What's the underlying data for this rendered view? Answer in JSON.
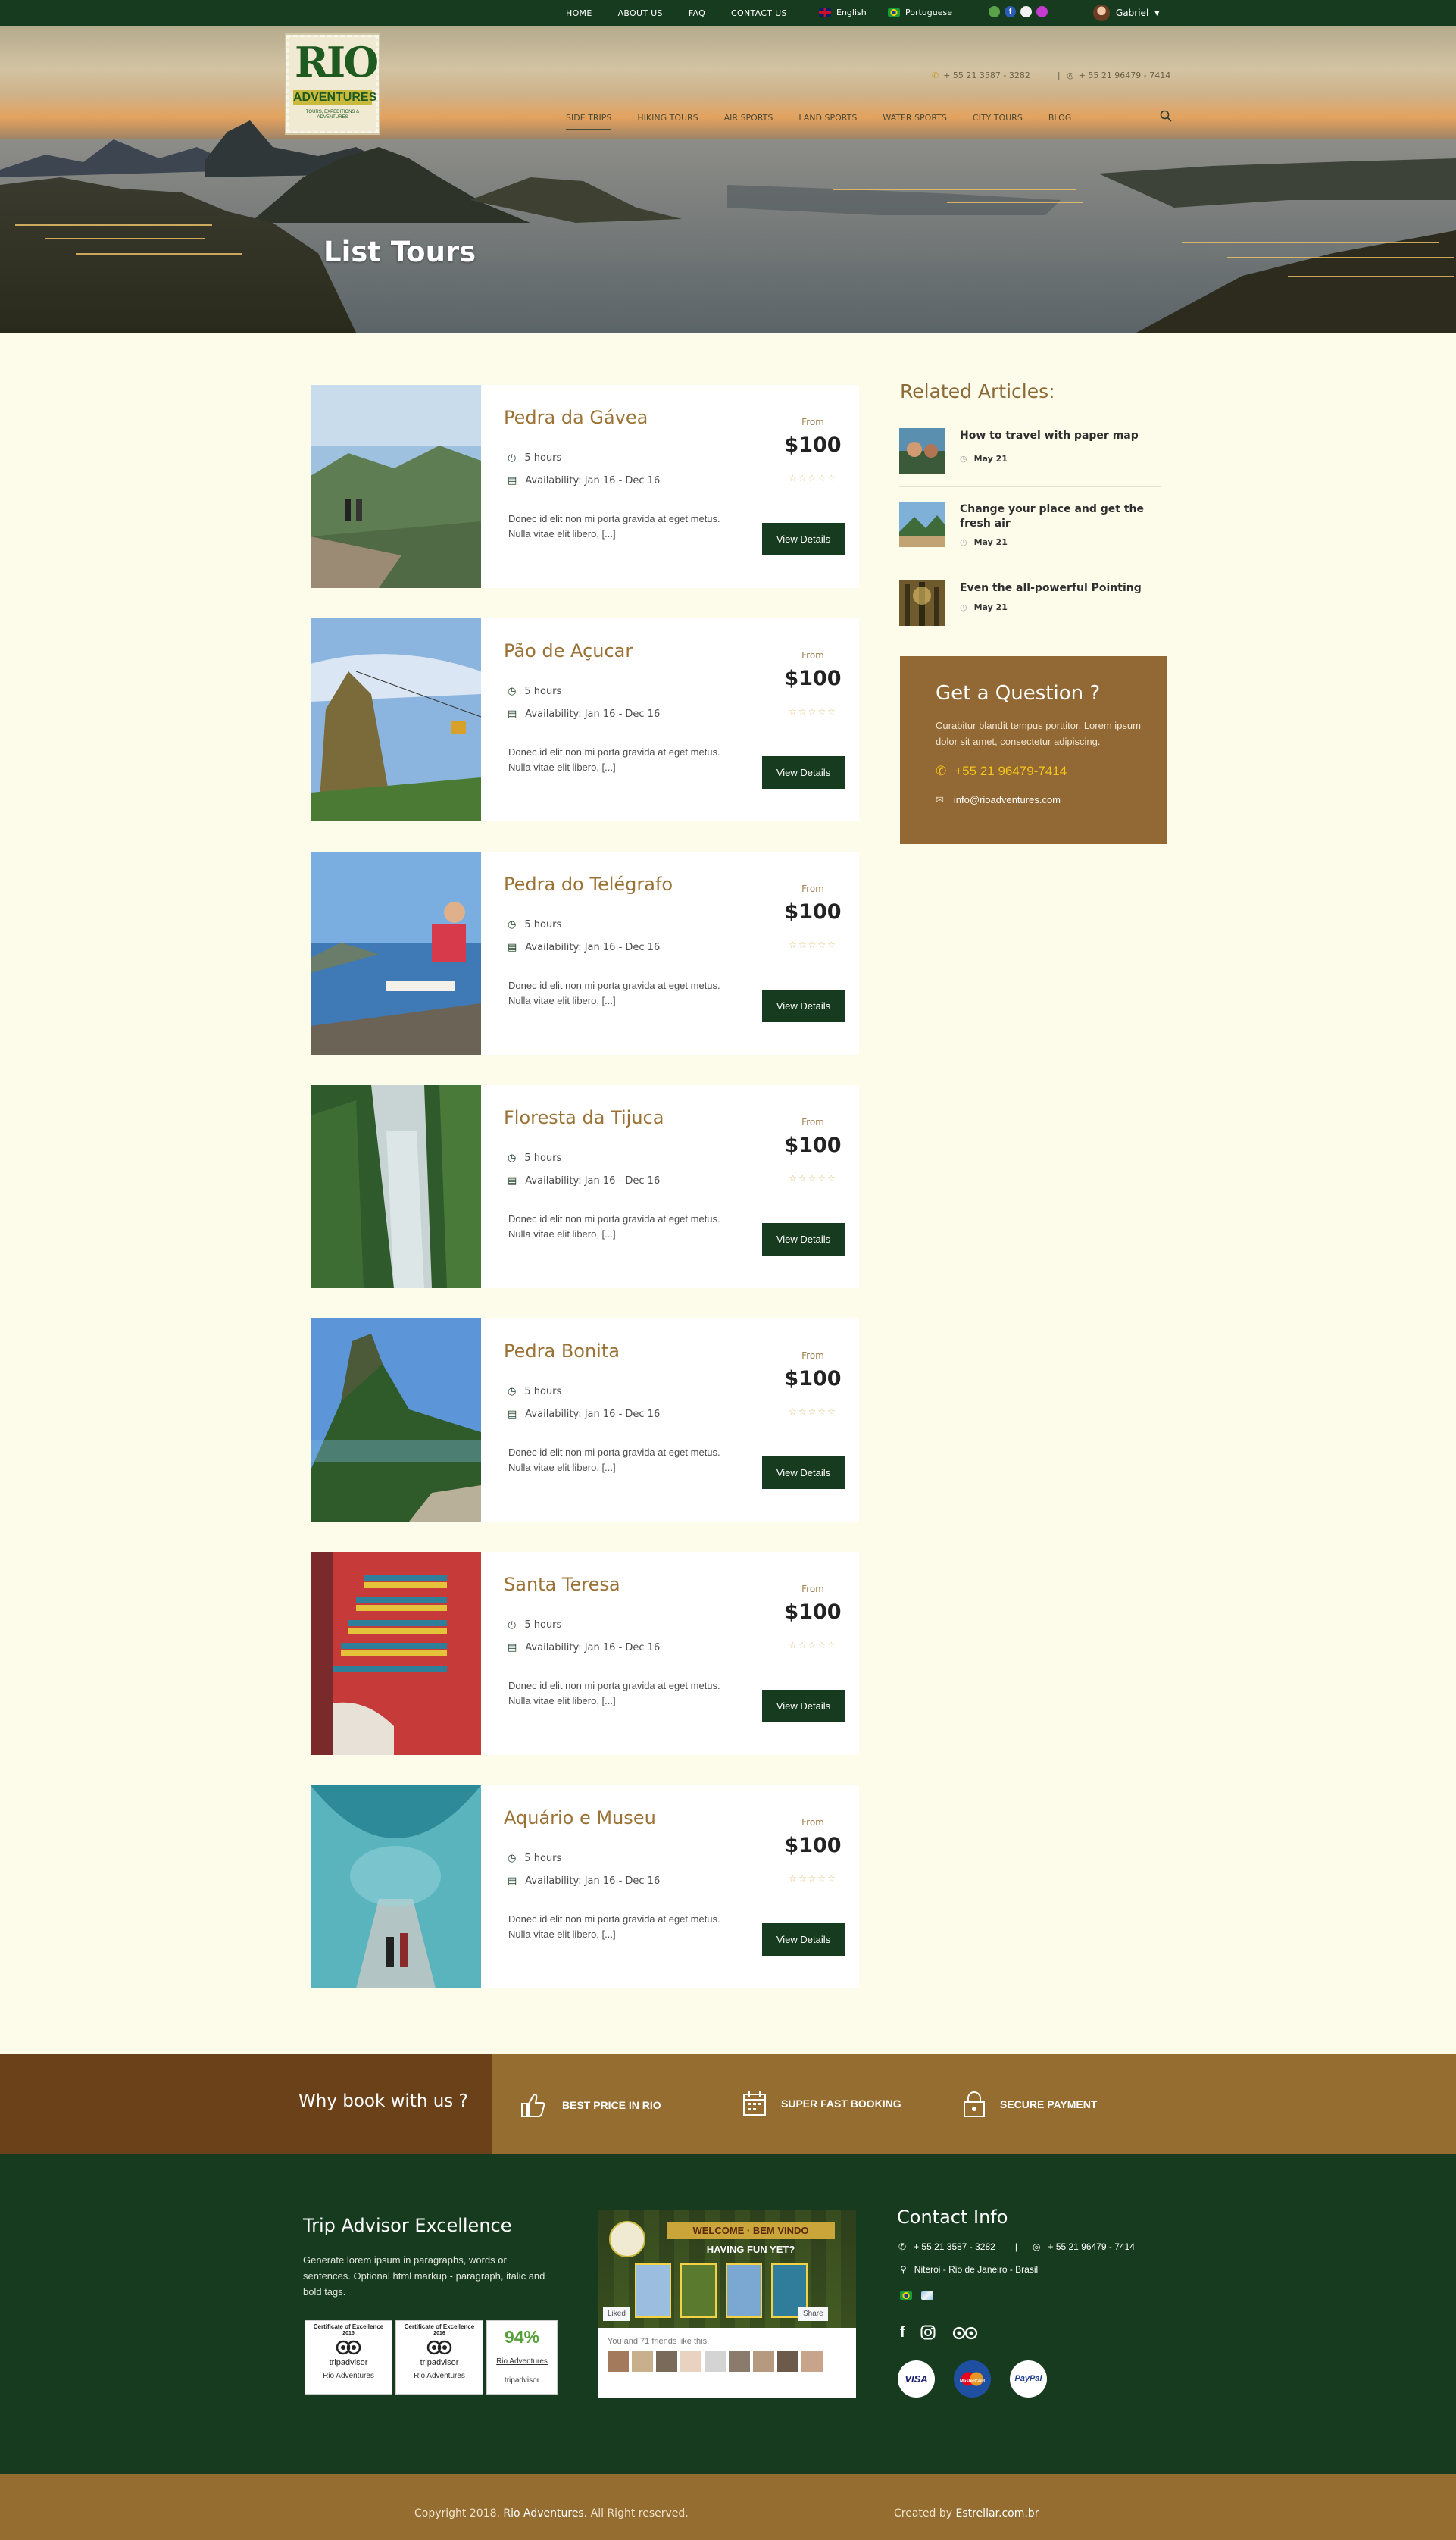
{
  "topbar": {
    "nav": [
      "HOME",
      "ABOUT US",
      "FAQ",
      "CONTACT US"
    ],
    "lang_en": "English",
    "lang_pt": "Portuguese",
    "user": "Gabriel",
    "social_icons": [
      "tripadvisor-icon",
      "facebook-icon",
      "tripadvisor-alt-icon",
      "instagram-icon"
    ]
  },
  "header": {
    "logo_title": "RIO",
    "logo_subtitle": "ADVENTURES",
    "logo_tagline": "TOURS, EXPEDITIONS & ADVENTURES",
    "phone": "+ 55 21 3587 - 3282",
    "separator": "|",
    "whatsapp": "+ 55 21 96479 - 7414",
    "nav": [
      "SIDE TRIPS",
      "HIKING TOURS",
      "AIR SPORTS",
      "LAND SPORTS",
      "WATER SPORTS",
      "CITY TOURS",
      "BLOG"
    ],
    "active_nav": "SIDE TRIPS"
  },
  "hero": {
    "title": "List Tours"
  },
  "tours": [
    {
      "title": "Pedra da Gávea",
      "duration": "5 hours",
      "availability": "Availability: Jan 16 - Dec 16",
      "description": "Donec id elit non mi porta gravida at eget metus. Nulla vitae elit libero, [...]",
      "from": "From",
      "price": "$100",
      "rating": 0,
      "button": "View Details"
    },
    {
      "title": "Pão de Açucar",
      "duration": "5 hours",
      "availability": "Availability: Jan 16 - Dec 16",
      "description": "Donec id elit non mi porta gravida at eget metus. Nulla vitae elit libero, [...]",
      "from": "From",
      "price": "$100",
      "rating": 0,
      "button": "View Details"
    },
    {
      "title": "Pedra do Telégrafo",
      "duration": "5 hours",
      "availability": "Availability: Jan 16 - Dec 16",
      "description": "Donec id elit non mi porta gravida at eget metus. Nulla vitae elit libero, [...]",
      "from": "From",
      "price": "$100",
      "rating": 0,
      "button": "View Details"
    },
    {
      "title": "Floresta da Tijuca",
      "duration": "5 hours",
      "availability": "Availability: Jan 16 - Dec 16",
      "description": "Donec id elit non mi porta gravida at eget metus. Nulla vitae elit libero, [...]",
      "from": "From",
      "price": "$100",
      "rating": 0,
      "button": "View Details"
    },
    {
      "title": "Pedra Bonita",
      "duration": "5 hours",
      "availability": "Availability: Jan 16 - Dec 16",
      "description": "Donec id elit non mi porta gravida at eget metus. Nulla vitae elit libero, [...]",
      "from": "From",
      "price": "$100",
      "rating": 0,
      "button": "View Details"
    },
    {
      "title": "Santa Teresa",
      "duration": "5 hours",
      "availability": "Availability: Jan 16 - Dec 16",
      "description": "Donec id elit non mi porta gravida at eget metus. Nulla vitae elit libero, [...]",
      "from": "From",
      "price": "$100",
      "rating": 0,
      "button": "View Details"
    },
    {
      "title": "Aquário e Museu",
      "duration": "5 hours",
      "availability": "Availability: Jan 16 - Dec 16",
      "description": "Donec id elit non mi porta gravida at eget metus. Nulla vitae elit libero, [...]",
      "from": "From",
      "price": "$100",
      "rating": 0,
      "button": "View Details"
    }
  ],
  "sidebar": {
    "related_title": "Related Articles:",
    "articles": [
      {
        "title": "How to travel with paper map",
        "date": "May 21"
      },
      {
        "title": "Change your place and get the fresh air",
        "date": "May 21"
      },
      {
        "title": "Even the all-powerful Pointing",
        "date": "May 21"
      }
    ],
    "question": {
      "title": "Get a Question ?",
      "text": "Curabitur blandit tempus porttitor. Lorem ipsum dolor sit amet, consectetur adipiscing.",
      "phone": "+55 21 96479-7414",
      "email": "info@rioadventures.com"
    }
  },
  "why": {
    "title": "Why book with us ?",
    "features": [
      "BEST PRICE IN RIO",
      "SUPER FAST BOOKING",
      "SECURE PAYMENT"
    ]
  },
  "footer": {
    "trip_title": "Trip Advisor Excellence",
    "trip_text": "Generate lorem ipsum in paragraphs, words or sentences. Optional html markup - paragraph, italic and bold tags.",
    "certs": [
      {
        "title": "Certificate of Excellence",
        "year": "2015",
        "brand": "tripadvisor",
        "link": "Rio Adventures"
      },
      {
        "title": "Certificate of Excellence",
        "year": "2016",
        "brand": "tripadvisor",
        "link": "Rio Adventures"
      }
    ],
    "rating_badge": {
      "value": "94%",
      "link": "Rio Adventures",
      "brand": "tripadvisor"
    },
    "fb": {
      "welcome": "WELCOME · BEM VINDO",
      "fun": "HAVING FUN YET?",
      "liked": "Liked",
      "share": "Share",
      "friends": "You and 71 friends like this."
    },
    "contact_title": "Contact Info",
    "phone": "+ 55 21 3587 - 3282",
    "separator": "|",
    "whatsapp": "+ 55 21 96479 - 7414",
    "address": "Niteroi - Rio de Janeiro - Brasil",
    "payments": [
      "VISA",
      "MasterCard",
      "PayPal"
    ]
  },
  "bottom": {
    "copyright_prefix": "Copyright 2018.",
    "brand": "Rio Adventures.",
    "rights": "All Right reserved.",
    "created_prefix": "Created by",
    "creator": "Estrellar.com.br"
  },
  "colors": {
    "dark_green": "#173b1f",
    "gold": "#926834",
    "brown": "#6b4119",
    "title_gold": "#9a7235",
    "yellow": "#f4c51c"
  }
}
